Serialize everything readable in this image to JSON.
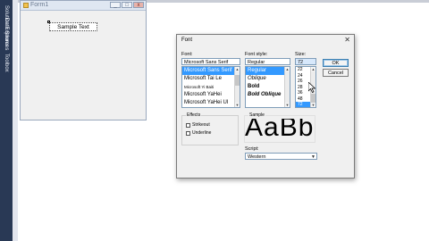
{
  "sidebar": {
    "tabs": [
      {
        "label": "Solution Explorer"
      },
      {
        "label": "Data Sources"
      },
      {
        "label": "Toolbox"
      }
    ]
  },
  "designer": {
    "form_title": "Form1",
    "controls": [
      "_",
      "□",
      "x"
    ],
    "sample_label": "Sample Text"
  },
  "dialog": {
    "title": "Font",
    "close_glyph": "✕",
    "font": {
      "label": "Font:",
      "value": "Microsoft Sans Serif",
      "items": [
        {
          "text": "Microsoft Sans Serif",
          "selected": true
        },
        {
          "text": "Microsoft Tai Le",
          "selected": false
        },
        {
          "text": "Microsoft Yi Baiti",
          "selected": false
        },
        {
          "text": "Microsoft YaHei",
          "selected": false
        },
        {
          "text": "Microsoft YaHei UI",
          "selected": false
        }
      ]
    },
    "style": {
      "label": "Font style:",
      "value": "Regular",
      "items": [
        {
          "text": "Regular",
          "selected": true
        },
        {
          "text": "Oblique",
          "selected": false
        },
        {
          "text": "Bold",
          "selected": false
        },
        {
          "text": "Bold Oblique",
          "selected": false
        }
      ]
    },
    "size": {
      "label": "Size:",
      "value": "72",
      "items": [
        {
          "text": "22",
          "selected": false
        },
        {
          "text": "24",
          "selected": false
        },
        {
          "text": "26",
          "selected": false
        },
        {
          "text": "28",
          "selected": false
        },
        {
          "text": "36",
          "selected": false
        },
        {
          "text": "48",
          "selected": false
        },
        {
          "text": "72",
          "selected": true
        }
      ]
    },
    "ok_label": "OK",
    "cancel_label": "Cancel",
    "effects": {
      "title": "Effects",
      "strikeout": "Strikeout",
      "underline": "Underline"
    },
    "sample": {
      "title": "Sample",
      "text": "AaBbYyZz"
    },
    "script": {
      "label": "Script:",
      "value": "Western"
    }
  }
}
